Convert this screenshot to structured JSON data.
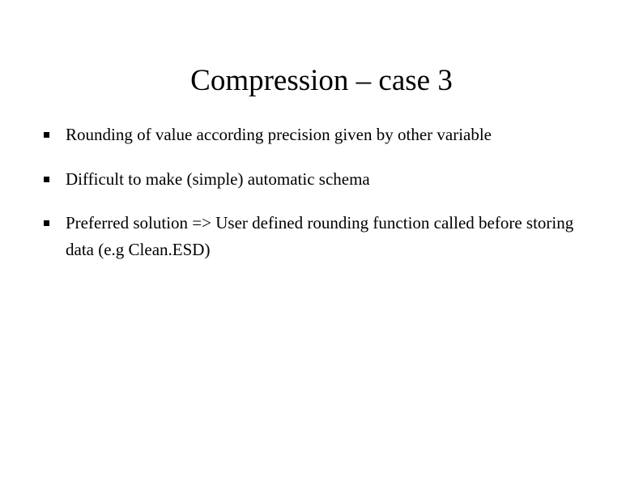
{
  "slide": {
    "title": "Compression – case 3",
    "bullets": [
      "Rounding of value according precision given by other variable",
      "Difficult to make (simple) automatic schema",
      "Preferred solution => User defined rounding function called before storing data (e.g Clean.ESD)"
    ]
  }
}
